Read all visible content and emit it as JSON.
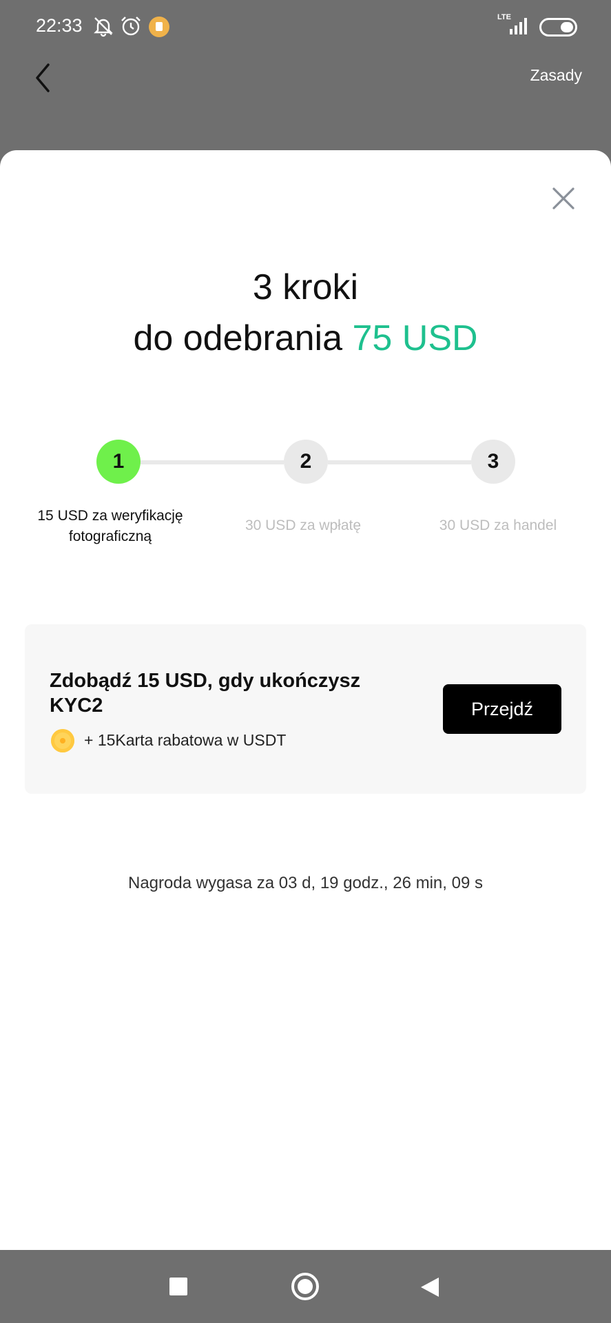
{
  "status_bar": {
    "time": "22:33",
    "network": "LTE",
    "icons": [
      "bell-off-icon",
      "alarm-icon",
      "app-notification-icon",
      "signal-icon",
      "battery-icon"
    ]
  },
  "header": {
    "back_icon": "chevron-left-icon",
    "rules_label": "Zasady"
  },
  "sheet": {
    "close_icon": "close-icon",
    "title_line1": "3 kroki",
    "title_line2_prefix": "do odebrania ",
    "title_amount": "75 USD",
    "accent_color": "#1ec08e",
    "steps": [
      {
        "number": "1",
        "label_line1": "15 USD za weryfikację",
        "label_line2": "fotograficzną",
        "active": true
      },
      {
        "number": "2",
        "label_line1": "30 USD za wpłatę",
        "label_line2": "",
        "active": false
      },
      {
        "number": "3",
        "label_line1": "30 USD za handel",
        "label_line2": "",
        "active": false
      }
    ],
    "active_step_color": "#6ff04b",
    "card": {
      "title_line1": "Zdobądź 15 USD, gdy ukończysz",
      "title_line2": "KYC2",
      "bonus_icon": "coin-icon",
      "bonus_text": "+ 15Karta rabatowa w USDT",
      "button_label": "Przejdź"
    },
    "expiry_text": "Nagroda wygasa za 03 d, 19 godz., 26 min, 09 s"
  },
  "nav_bar": {
    "icons": [
      "recent-apps-icon",
      "home-icon",
      "back-icon"
    ]
  }
}
